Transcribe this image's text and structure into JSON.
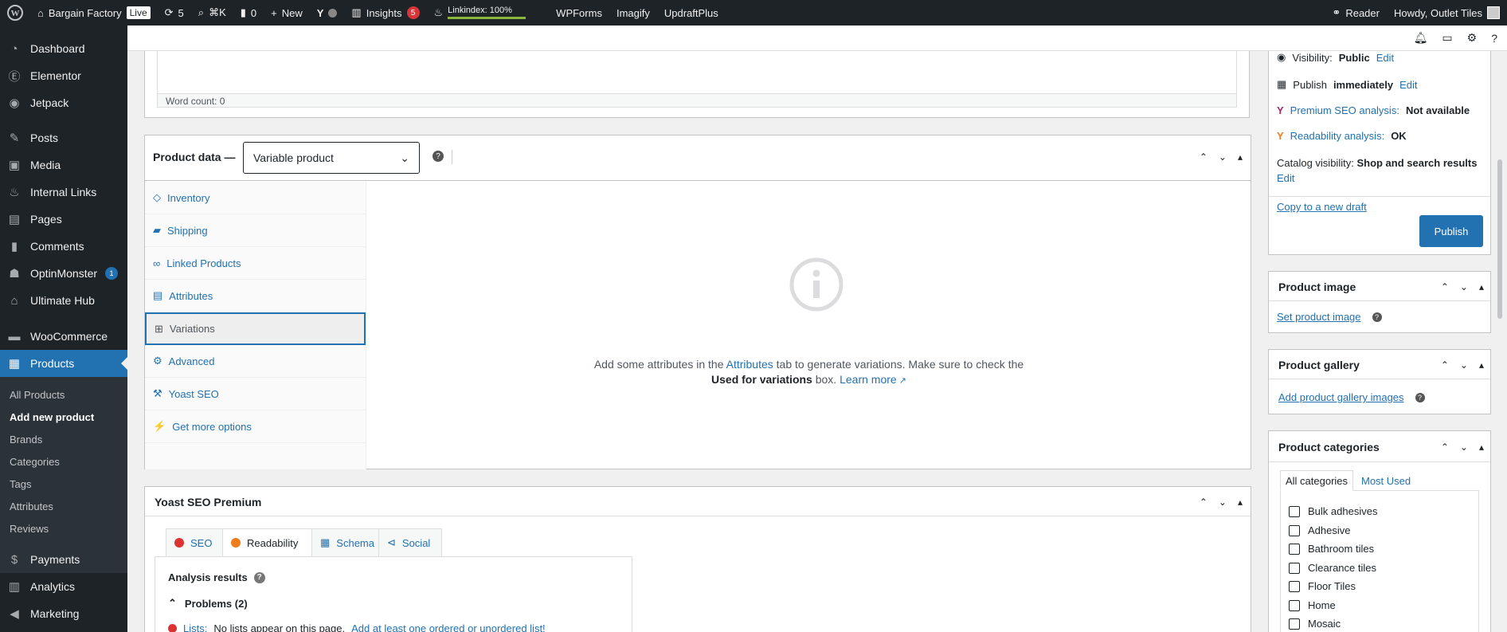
{
  "adminbar": {
    "site": "Bargain Factory",
    "live": "Live",
    "updates": "5",
    "shortcut": "⌘K",
    "comments": "0",
    "new": "New",
    "insights": "Insights",
    "insights_count": "5",
    "linkindex": "Linkindex: 100%",
    "wpforms": "WPForms",
    "imagify": "Imagify",
    "updraft": "UpdraftPlus",
    "reader": "Reader",
    "howdy": "Howdy, Outlet Tiles"
  },
  "sidebar": {
    "dashboard": "Dashboard",
    "elementor": "Elementor",
    "jetpack": "Jetpack",
    "posts": "Posts",
    "media": "Media",
    "internal_links": "Internal Links",
    "pages": "Pages",
    "comments": "Comments",
    "optinmonster": "OptinMonster",
    "optinmonster_badge": "1",
    "ultimate_hub": "Ultimate Hub",
    "woocommerce": "WooCommerce",
    "products": "Products",
    "sub": {
      "all_products": "All Products",
      "add_new": "Add new product",
      "brands": "Brands",
      "categories": "Categories",
      "tags": "Tags",
      "attributes": "Attributes",
      "reviews": "Reviews"
    },
    "payments": "Payments",
    "analytics": "Analytics",
    "marketing": "Marketing"
  },
  "editor": {
    "word_count": "Word count: 0"
  },
  "product_data": {
    "label": "Product data —",
    "type": "Variable product",
    "tabs": [
      "Inventory",
      "Shipping",
      "Linked Products",
      "Attributes",
      "Variations",
      "Advanced",
      "Yoast SEO",
      "Get more options"
    ],
    "msg_pre": "Add some attributes in the",
    "msg_link": "Attributes",
    "msg_mid": "tab to generate variations. Make sure to check the",
    "msg_bold": "Used for variations",
    "msg_post": "box.",
    "learn_more": "Learn more"
  },
  "yoast": {
    "title": "Yoast SEO Premium",
    "tabs": {
      "seo": "SEO",
      "readability": "Readability",
      "schema": "Schema",
      "social": "Social"
    },
    "analysis_title": "Analysis results",
    "problems": "Problems (2)",
    "problem1_label": "Lists:",
    "problem1_text": "No lists appear on this page.",
    "problem1_link": "Add at least one ordered or unordered list!"
  },
  "publish": {
    "visibility_label": "Visibility:",
    "visibility_value": "Public",
    "edit": "Edit",
    "publish_label": "Publish",
    "publish_value": "immediately",
    "seo_link": "Premium SEO analysis:",
    "seo_value": "Not available",
    "read_link": "Readability analysis:",
    "read_value": "OK",
    "catalog_label": "Catalog visibility:",
    "catalog_value": "Shop and search results",
    "copy_draft": "Copy to a new draft",
    "publish_button": "Publish"
  },
  "product_image": {
    "title": "Product image",
    "link": "Set product image"
  },
  "product_gallery": {
    "title": "Product gallery",
    "link": "Add product gallery images"
  },
  "product_categories": {
    "title": "Product categories",
    "tab_all": "All categories",
    "tab_most": "Most Used",
    "items": [
      "Bulk adhesives",
      "Adhesive",
      "Bathroom tiles",
      "Clearance tiles",
      "Floor Tiles",
      "Home",
      "Mosaic"
    ]
  }
}
